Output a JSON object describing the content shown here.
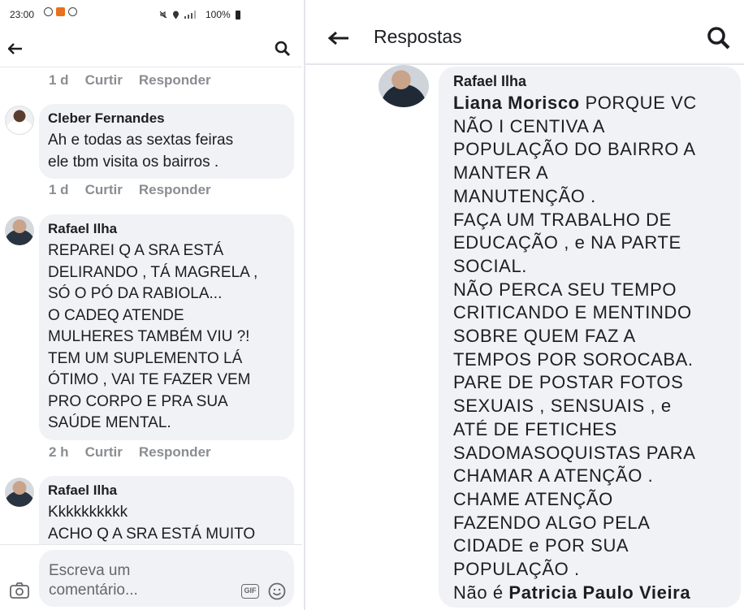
{
  "left": {
    "status": {
      "time": "23:00",
      "battery": "100%"
    },
    "comments": [
      {
        "meta": {
          "time": "1 d",
          "like": "Curtir",
          "reply": "Responder"
        }
      },
      {
        "author": "Cleber Fernandes",
        "text": "Ah e todas as sextas feiras\nele tbm visita os bairros .",
        "meta": {
          "time": "1 d",
          "like": "Curtir",
          "reply": "Responder"
        }
      },
      {
        "author": "Rafael Ilha",
        "text": "REPAREI Q A SRA ESTÁ\nDELIRANDO , TÁ MAGRELA ,\nSÓ O PÓ DA RABIOLA...\nO CADEQ ATENDE\nMULHERES TAMBÉM VIU ?!\nTEM UM SUPLEMENTO LÁ\nÓTIMO , VAI TE FAZER VEM\nPRO CORPO E PRA SUA\nSAÚDE MENTAL.",
        "meta": {
          "time": "2 h",
          "like": "Curtir",
          "reply": "Responder"
        }
      },
      {
        "author": "Rafael Ilha",
        "text": "Kkkkkkkkkk\nACHO Q A SRA ESTÁ MUITO"
      }
    ],
    "composer": {
      "placeholder": "Escreva um comentário...",
      "gif": "GIF"
    }
  },
  "right": {
    "title": "Respostas",
    "reply": {
      "author": "Rafael Ilha",
      "mention_start": "Liana Morisco",
      "line1_rest": " PORQUE VC",
      "lines": [
        "NÃO I CENTIVA A",
        "POPULAÇÃO DO BAIRRO A",
        "MANTER A",
        "MANUTENÇÃO .",
        "FAÇA UM TRABALHO DE",
        "EDUCAÇÃO , e NA PARTE",
        "SOCIAL.",
        "NÃO PERCA SEU TEMPO",
        "CRITICANDO E MENTINDO",
        "SOBRE QUEM FAZ A",
        "TEMPOS POR SOROCABA.",
        "PARE DE POSTAR FOTOS",
        "SEXUAIS , SENSUAIS , e",
        "ATÉ DE FETICHES",
        "SADOMASOQUISTAS PARA",
        "CHAMAR A ATENÇÃO .",
        "CHAME ATENÇÃO",
        "FAZENDO ALGO PELA",
        "CIDADE e POR SUA",
        "POPULAÇÃO ."
      ],
      "last_prefix": "Não é ",
      "mention_end": "Patricia Paulo Vieira"
    }
  }
}
